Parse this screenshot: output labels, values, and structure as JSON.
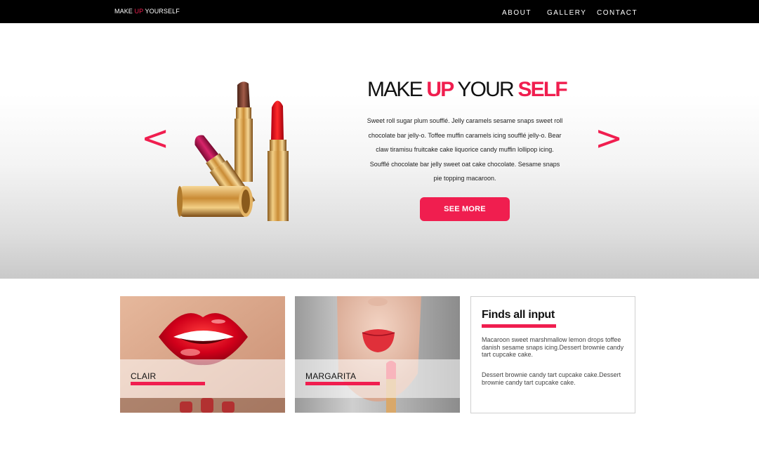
{
  "brand": {
    "part1": "MAKE ",
    "accent": "UP",
    "part2": " YOURSELF"
  },
  "nav": {
    "about": "ABOUT",
    "gallery": "GALLERY",
    "contact": "CONTACT"
  },
  "hero": {
    "title_part1": "MAKE ",
    "title_accent1": "UP",
    "title_part2": " YOUR ",
    "title_accent2": "SELF",
    "text": "Sweet roll sugar plum soufflé. Jelly caramels sesame snaps sweet roll chocolate bar jelly-o. Toffee muffin caramels icing soufflé jelly-o. Bear claw tiramisu fruitcake cake liquorice candy muffin lollipop icing. Soufflé chocolate bar jelly sweet oat cake chocolate. Sesame snaps pie topping macaroon.",
    "button": "SEE MORE",
    "prev": "<",
    "next": ">"
  },
  "cards": [
    {
      "label": "CLAIR"
    },
    {
      "label": "MARGARITA"
    }
  ],
  "info": {
    "title": "Finds all input",
    "p1": "Macaroon sweet marshmallow lemon drops toffee danish sesame snaps icing.Dessert brownie candy tart cupcake cake.",
    "p2": "Dessert brownie candy tart cupcake cake.Dessert brownie candy tart cupcake cake."
  },
  "colors": {
    "accent": "#f01e4f",
    "navbar": "#000000"
  }
}
